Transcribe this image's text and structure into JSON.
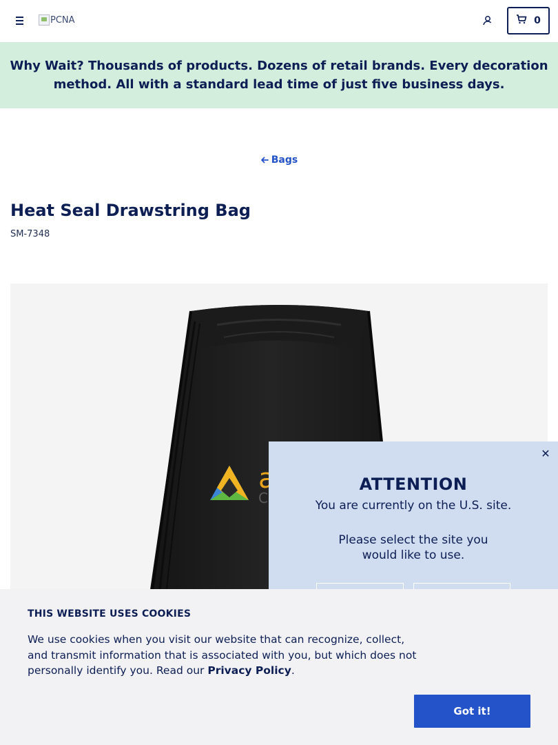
{
  "header": {
    "logo_alt": "PCNA",
    "cart_count": "0",
    "icons": {
      "menu": "menu-icon",
      "account": "account-icon",
      "cart": "cart-icon"
    }
  },
  "promo": {
    "lead": "Why Wait?",
    "text": " Thousands of products. Dozens of retail brands. Every decoration method. All with a standard lead time of just five business days."
  },
  "breadcrumb": {
    "back_label": "Bags",
    "icon": "arrow-left-icon"
  },
  "product": {
    "title": "Heat Seal Drawstring Bag",
    "sku": "SM-7348"
  },
  "site_modal": {
    "title": "ATTENTION",
    "current_site": "You are currently on the U.S. site.",
    "prompt": "Please select the site you would like to use.",
    "close_icon": "close-icon"
  },
  "cookie_banner": {
    "title": "THIS WEBSITE USES COOKIES",
    "text": "We use cookies when you visit our website that can recognize, collect, and transmit information that is associated with you, but which does not personally identify you. Read our ",
    "link_label": "Privacy Policy",
    "trailing": ".",
    "accept_label": "Got it!"
  },
  "colors": {
    "navy": "#0c1e54",
    "accent_blue": "#2452c8",
    "promo_bg": "#d4eedd",
    "modal_bg": "#d0dcf0",
    "cookie_bg": "#f2f2f4"
  }
}
